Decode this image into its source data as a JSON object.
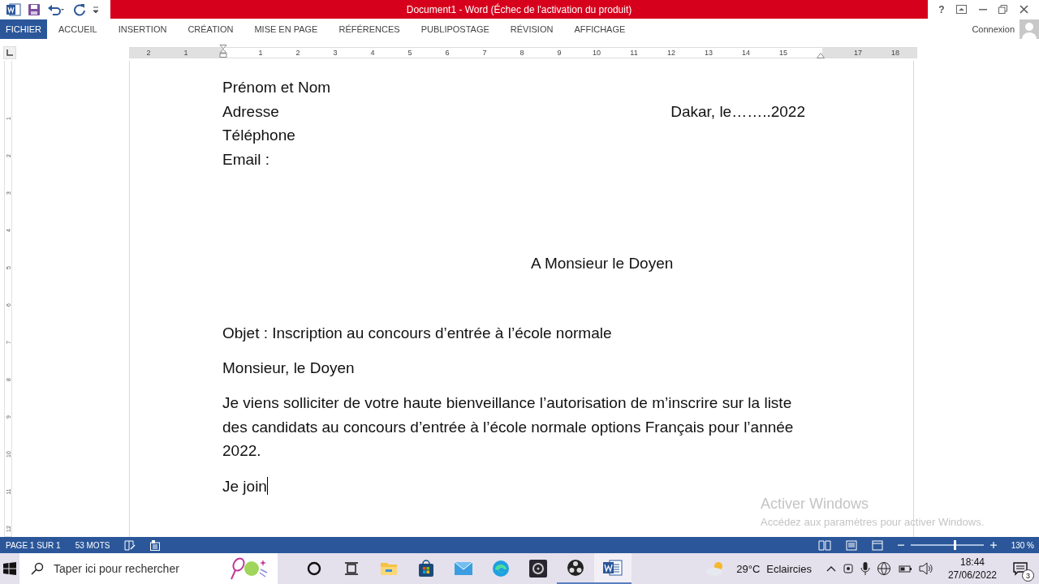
{
  "window": {
    "title": "Document1 - Word (Échec de l'activation du produit)",
    "help": "?"
  },
  "ribbon": {
    "tabs": [
      {
        "label": "FICHIER",
        "kind": "file"
      },
      {
        "label": "ACCUEIL",
        "kind": "tab"
      },
      {
        "label": "INSERTION",
        "kind": "tab"
      },
      {
        "label": "CRÉATION",
        "kind": "tab"
      },
      {
        "label": "MISE EN PAGE",
        "kind": "tab"
      },
      {
        "label": "RÉFÉRENCES",
        "kind": "tab"
      },
      {
        "label": "PUBLIPOSTAGE",
        "kind": "tab"
      },
      {
        "label": "RÉVISION",
        "kind": "tab"
      },
      {
        "label": "AFFICHAGE",
        "kind": "tab"
      }
    ],
    "account": "Connexion"
  },
  "ruler": {
    "marks": [
      {
        "kind": "number",
        "label": "2"
      },
      {
        "kind": "number",
        "label": "1"
      },
      {
        "kind": "indent-left"
      },
      {
        "kind": "number",
        "label": "1"
      },
      {
        "kind": "number",
        "label": "2"
      },
      {
        "kind": "number",
        "label": "3"
      },
      {
        "kind": "number",
        "label": "4"
      },
      {
        "kind": "number",
        "label": "5"
      },
      {
        "kind": "number",
        "label": "6"
      },
      {
        "kind": "number",
        "label": "7"
      },
      {
        "kind": "number",
        "label": "8"
      },
      {
        "kind": "number",
        "label": "9"
      },
      {
        "kind": "number",
        "label": "10"
      },
      {
        "kind": "number",
        "label": "11"
      },
      {
        "kind": "number",
        "label": "12"
      },
      {
        "kind": "number",
        "label": "13"
      },
      {
        "kind": "number",
        "label": "14"
      },
      {
        "kind": "number",
        "label": "15"
      },
      {
        "kind": "indent-right"
      },
      {
        "kind": "number",
        "label": "17"
      },
      {
        "kind": "number",
        "label": "18"
      }
    ],
    "vertical_numbers": [
      "1",
      "2",
      "3",
      "4",
      "5",
      "6",
      "7",
      "8",
      "9",
      "10",
      "11",
      "12"
    ]
  },
  "document": {
    "sender_lines": [
      "Prénom et Nom",
      "Adresse",
      "Téléphone",
      "Email :"
    ],
    "date": "Dakar, le……..2022",
    "recipient": "A Monsieur le Doyen",
    "subject": "Objet : Inscription au concours d’entrée à l’école normale",
    "salutation": "Monsieur, le Doyen",
    "paragraph": "Je viens solliciter de votre haute bienveillance l’autorisation de m’inscrire sur la liste des candidats au concours d’entrée à l’école normale options Français pour l’année 2022.",
    "last_line": "Je join"
  },
  "activation": {
    "title": "Activer Windows",
    "subtitle": "Accédez aux paramètres pour activer Windows."
  },
  "status_bar": {
    "page": "PAGE 1 SUR 1",
    "words": "53 MOTS",
    "zoom": "130 %",
    "level": 0.6
  },
  "taskbar": {
    "search_placeholder": "Taper ici pour rechercher",
    "apps": [
      {
        "kind": "cortana",
        "running": false,
        "active": false
      },
      {
        "kind": "taskview",
        "running": false,
        "active": false
      },
      {
        "kind": "explorer",
        "running": false,
        "active": false
      },
      {
        "kind": "store",
        "running": false,
        "active": false
      },
      {
        "kind": "mail",
        "running": false,
        "active": false
      },
      {
        "kind": "edge",
        "running": false,
        "active": false
      },
      {
        "kind": "video",
        "running": false,
        "active": false
      },
      {
        "kind": "obs",
        "running": true,
        "active": false
      },
      {
        "kind": "word",
        "running": true,
        "active": true
      }
    ],
    "temperature": "29°C",
    "weather": "Eclaircies",
    "time": "18:44",
    "date": "27/06/2022",
    "notifications": "3"
  }
}
